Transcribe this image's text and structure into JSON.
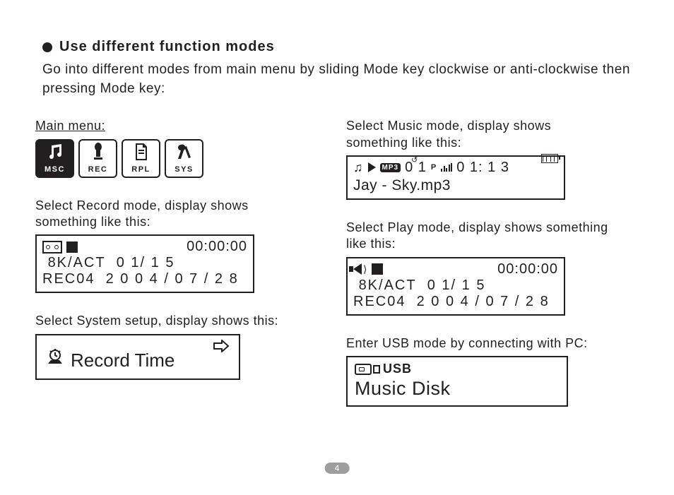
{
  "heading": "Use different function modes",
  "intro": "Go into different modes from main menu by sliding Mode key clockwise or anti-clockwise then pressing Mode key:",
  "main_menu": {
    "caption": "Main menu:",
    "items": [
      {
        "label": "MSC",
        "active": true
      },
      {
        "label": "REC",
        "active": false
      },
      {
        "label": "RPL",
        "active": false
      },
      {
        "label": "SYS",
        "active": false
      }
    ]
  },
  "record_mode": {
    "caption": "Select Record mode, display shows something like this:",
    "timer": "00:00:00",
    "line2_left": "8K/ACT",
    "line2_right": "0 1/ 1 5",
    "line3_left": "REC04",
    "line3_right": "2 0 0 4 / 0 7 / 2 8"
  },
  "system_setup": {
    "caption": "Select System setup, display shows this:",
    "label": "Record Time"
  },
  "music_mode": {
    "caption": "Select Music mode, display shows something like this:",
    "format_badge": "MP3",
    "track_num": "0 1",
    "time": "0 1: 1 3",
    "filename": "Jay - Sky.mp3"
  },
  "play_mode": {
    "caption": "Select Play mode, display shows something like this:",
    "timer": "00:00:00",
    "line2_left": "8K/ACT",
    "line2_right": "0 1/ 1 5",
    "line3_left": "REC04",
    "line3_right": "2 0 0 4 / 0 7 / 2 8"
  },
  "usb_mode": {
    "caption": "Enter USB mode by connecting with PC:",
    "badge": "USB",
    "title": "Music Disk"
  },
  "page_number": "4"
}
